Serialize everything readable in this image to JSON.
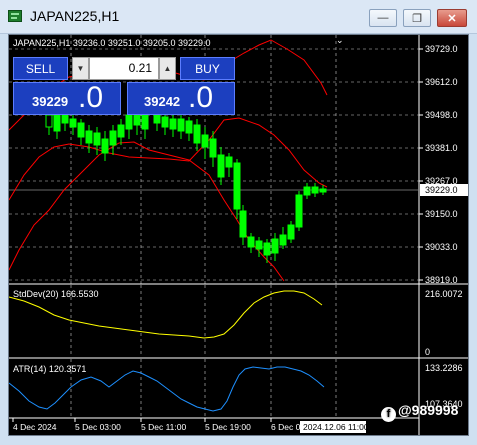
{
  "window": {
    "title": "JAPAN225,H1",
    "min_glyph": "—",
    "max_glyph": "❐",
    "close_glyph": "✕"
  },
  "chart": {
    "header": "JAPAN225,H1  39236.0 39251.0 39205.0 39229.0",
    "price_axis": [
      "39729.0",
      "39612.0",
      "39498.0",
      "39381.0",
      "39267.0",
      "39150.0",
      "39033.0",
      "38919.0"
    ],
    "current_price": "39229.0",
    "time_axis": [
      "4 Dec 2024",
      "5 Dec 03:00",
      "5 Dec 11:00",
      "5 Dec 19:00",
      "6 Dec 03:00"
    ],
    "time_cursor_label": "2024.12.06 11:00",
    "colors": {
      "bull": "#00ff00",
      "band": "#ff0000",
      "stddev": "#ffff00",
      "atr": "#1e90ff",
      "grid": "#ffffff"
    }
  },
  "stddev": {
    "label": "StdDev(20) 166.5530",
    "axis_top": "216.0072",
    "axis_bottom": "0"
  },
  "atr": {
    "label": "ATR(14) 120.3571",
    "axis_top": "133.2286",
    "axis_bottom": "107.3640"
  },
  "trade_panel": {
    "sell_label": "SELL",
    "buy_label": "BUY",
    "volume": "0.21",
    "dec_glyph": "▼",
    "inc_glyph": "▲",
    "bid_small": "39229",
    "bid_big": ".0",
    "ask_small": "39242",
    "ask_big": ".0"
  },
  "watermark": {
    "logo": "f",
    "text": "@989998"
  }
}
